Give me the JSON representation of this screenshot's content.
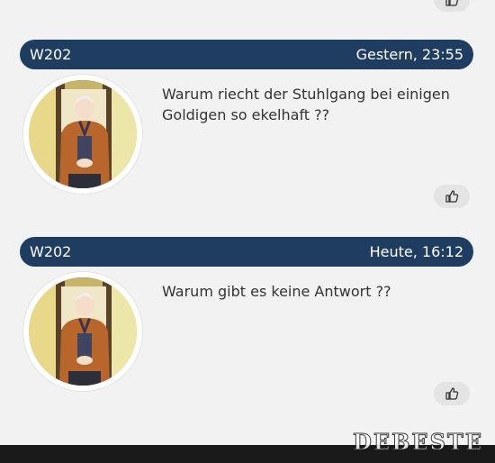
{
  "posts": [
    {
      "author": "W202",
      "time": "Gestern, 23:55",
      "text": "Warum riecht der Stuhlgang bei einigen Goldigen so ekelhaft  ??"
    },
    {
      "author": "W202",
      "time": "Heute, 16:12",
      "text": "Warum gibt es keine Antwort  ??"
    }
  ],
  "icons": {
    "like": "thumbs-up-icon",
    "avatar": "user-avatar"
  },
  "colors": {
    "header_bg": "#1e3d61",
    "header_text": "#ffffff",
    "page_bg": "#f2f2f2",
    "like_bg": "#e4e4e4"
  },
  "brand": {
    "logo_text": "DEBESTE"
  }
}
